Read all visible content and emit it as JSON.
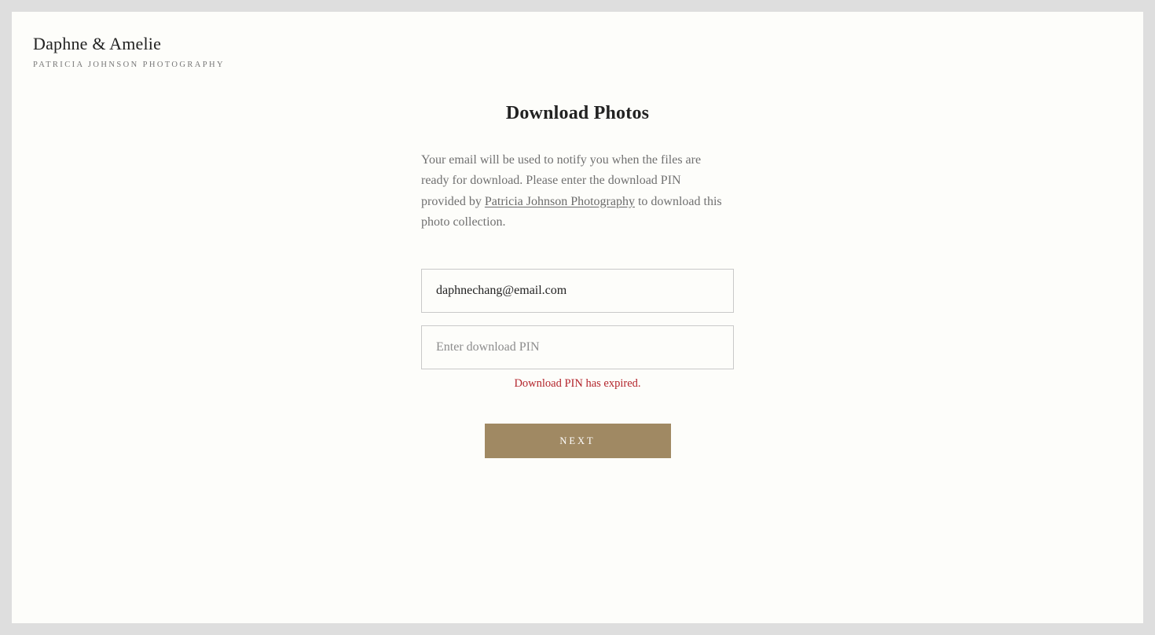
{
  "brand": {
    "title": "Daphne & Amelie",
    "subtitle": "PATRICIA JOHNSON PHOTOGRAPHY"
  },
  "page": {
    "title": "Download Photos",
    "intro_before": "Your email will be used to notify you when the files are ready for download. Please enter the download PIN provided by ",
    "intro_link": "Patricia Johnson Photography",
    "intro_after": " to download this photo collection."
  },
  "form": {
    "email_value": "daphnechang@email.com",
    "pin_placeholder": "Enter download PIN",
    "pin_value": "",
    "error": "Download PIN has expired.",
    "next_label": "NEXT"
  },
  "colors": {
    "accent": "#a08963",
    "error": "#b3242b",
    "background": "#fdfdfa"
  }
}
